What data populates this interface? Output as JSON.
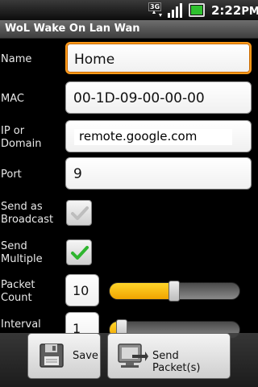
{
  "status_bar": {
    "network": "3G",
    "time": "2:22",
    "time_suffix": "PM",
    "icons": [
      "3g-data-icon",
      "signal-strength-icon",
      "battery-charging-icon"
    ]
  },
  "title_bar": {
    "title": "WoL Wake On Lan Wan"
  },
  "form": {
    "name_label": "Name",
    "name_value": "Home",
    "mac_label": "MAC",
    "mac_value": "00-1D-09-00-00-00",
    "ip_label": "IP or Domain",
    "ip_value": "remote.google.com",
    "port_label": "Port",
    "port_value": "9",
    "broadcast_label": "Send as Broadcast",
    "broadcast_checked": false,
    "multiple_label": "Send Multiple",
    "multiple_checked": true,
    "packet_count_label": "Packet Count",
    "packet_count_value": "10",
    "packet_count_progress": 0.5,
    "interval_label": "Interval",
    "interval_value": "1",
    "interval_progress": 0.1
  },
  "actions": {
    "save_label": "Save",
    "send_label": "Send Packet(s)"
  },
  "colors": {
    "focus_border": "#ff9a1a",
    "seek_progress": "#f0a400",
    "check_green": "#2fb52f"
  }
}
